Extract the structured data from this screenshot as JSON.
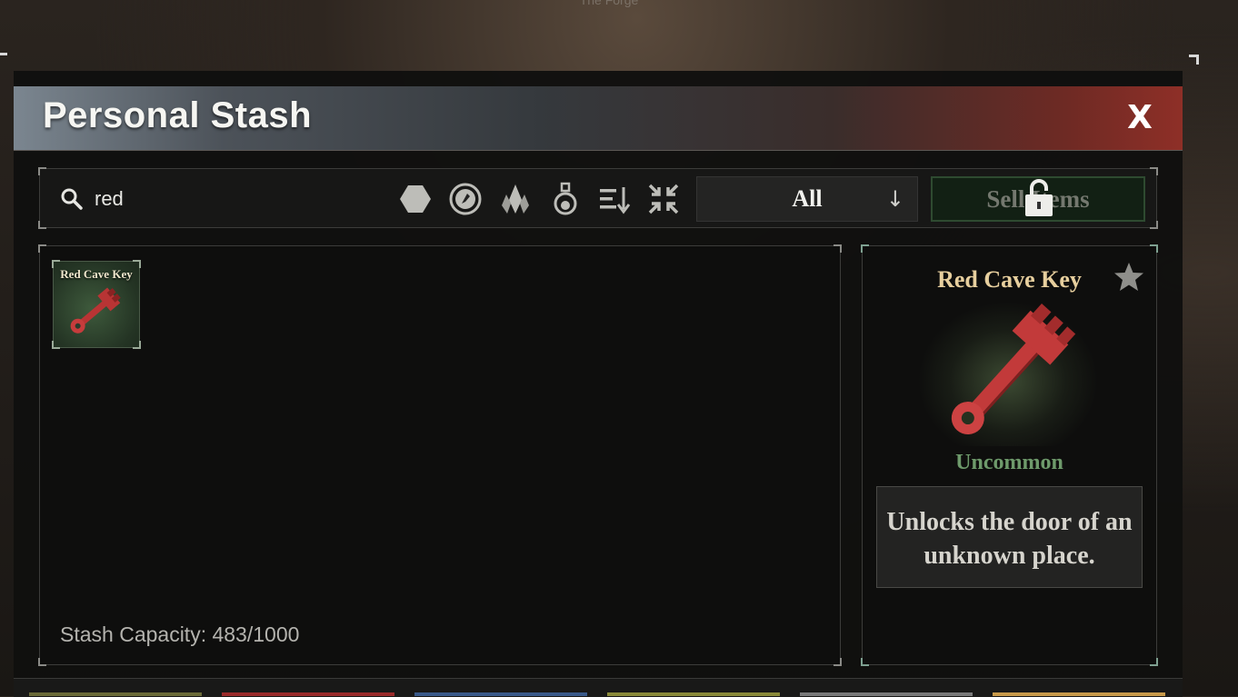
{
  "background_caption": "The Forge",
  "window": {
    "title": "Personal Stash",
    "close_label": "X"
  },
  "toolbar": {
    "search_value": "red",
    "filter_icons": [
      "hexagon-icon",
      "coin-icon",
      "crystals-icon",
      "potion-icon",
      "sort-icon",
      "collapse-icon"
    ],
    "category_select": "All",
    "sell_label": "Sell Items"
  },
  "stash": {
    "items": [
      {
        "label": "Red Cave Key",
        "icon": "red-key-icon"
      }
    ],
    "capacity_text": "Stash Capacity: 483/1000"
  },
  "detail": {
    "name": "Red Cave Key",
    "rarity": "Uncommon",
    "description": "Unlocks the door of an unknown place.",
    "colors": {
      "name": "#e7cf9e",
      "rarity": "#6e9a6b",
      "key": "#c23a3a"
    }
  },
  "bottom_tab_colors": [
    "#6a6a38",
    "#9a2a2a",
    "#3a5a8a",
    "#8a8a3a",
    "#7a7a7a",
    "#c89a4a"
  ]
}
